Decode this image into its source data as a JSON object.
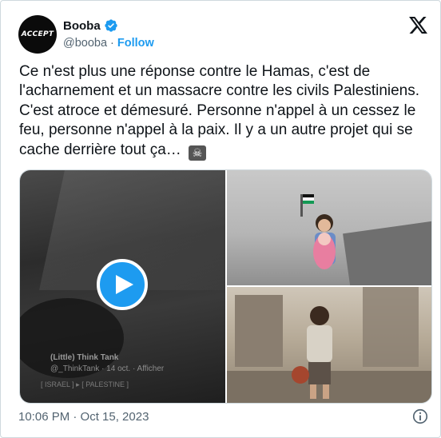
{
  "author": {
    "avatar_text": "ACCEPT",
    "name": "Booba",
    "handle": "@booba",
    "follow_label": "Follow",
    "separator": "·"
  },
  "tweet": {
    "text": "Ce n'est plus une réponse contre le Hamas, c'est de l'acharnement et un massacre contre les civils Palestiniens. C'est atroce et démesuré. Personne n'appel à un cessez le feu, personne n'appel à la paix. Il y a un autre projet qui se cache derrière tout ça…",
    "emoji": "☠"
  },
  "media": {
    "video_watermark": {
      "title": "(Little) Think Tank",
      "meta": "@_ThinkTank · 14 oct. · Afficher",
      "tags": "[ ISRAEL ] ▸ [ PALESTINE ]"
    }
  },
  "footer": {
    "timestamp": "10:06 PM · Oct 15, 2023"
  },
  "colors": {
    "accent": "#1d9bf0",
    "text": "#0f1419",
    "secondary": "#536471"
  },
  "icons": [
    "verified-badge-icon",
    "x-logo-icon",
    "play-icon",
    "info-icon",
    "skull-crossbones-icon"
  ]
}
